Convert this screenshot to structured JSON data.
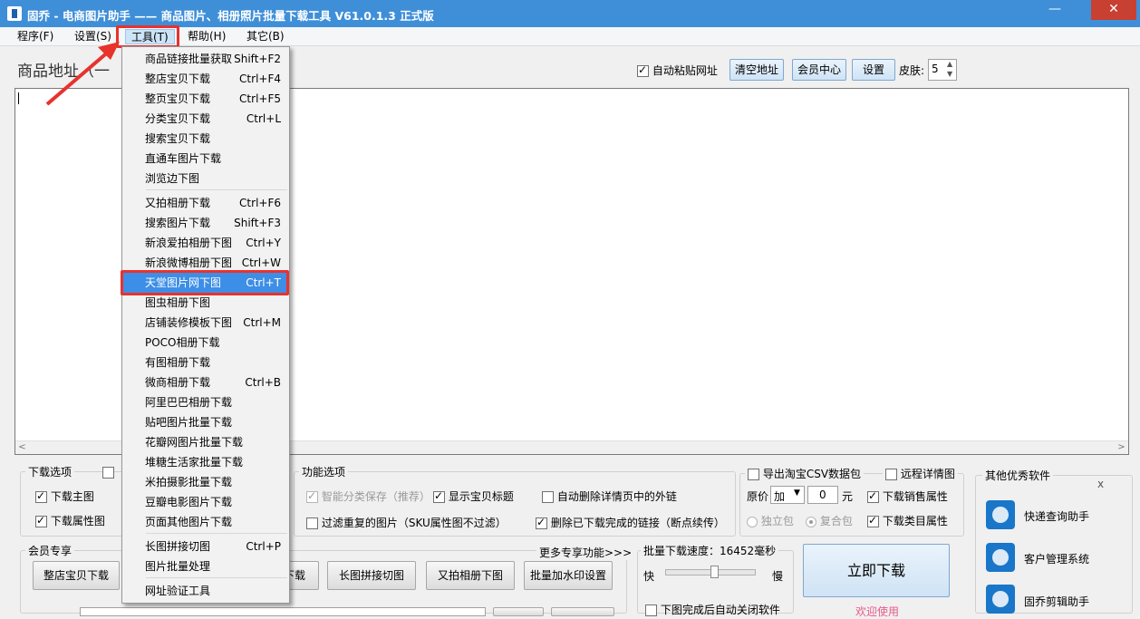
{
  "window": {
    "title": "固乔 - 电商图片助手 —— 商品图片、相册照片批量下载工具 V61.0.1.3 正式版",
    "minimize": "—",
    "close": "✕"
  },
  "menubar": [
    "程序(F)",
    "设置(S)",
    "工具(T)",
    "帮助(H)",
    "其它(B)"
  ],
  "main": {
    "url_label": "商品地址（一",
    "auto_paste": "自动粘贴网址",
    "clear_btn": "清空地址",
    "member_btn": "会员中心",
    "settings_btn": "设置",
    "skin_label": "皮肤:",
    "skin_value": "5"
  },
  "dropdown": [
    {
      "label": "商品链接批量获取",
      "shortcut": "Shift+F2"
    },
    {
      "label": "整店宝贝下载",
      "shortcut": "Ctrl+F4"
    },
    {
      "label": "整页宝贝下载",
      "shortcut": "Ctrl+F5"
    },
    {
      "label": "分类宝贝下载",
      "shortcut": "Ctrl+L"
    },
    {
      "label": "搜索宝贝下载",
      "shortcut": ""
    },
    {
      "label": "直通车图片下载",
      "shortcut": ""
    },
    {
      "label": "浏览边下图",
      "shortcut": ""
    },
    {
      "label": "又拍相册下载",
      "shortcut": "Ctrl+F6"
    },
    {
      "label": "搜索图片下载",
      "shortcut": "Shift+F3"
    },
    {
      "label": "新浪爱拍相册下图",
      "shortcut": "Ctrl+Y"
    },
    {
      "label": "新浪微博相册下图",
      "shortcut": "Ctrl+W"
    },
    {
      "label": "天堂图片网下图",
      "shortcut": "Ctrl+T"
    },
    {
      "label": "图虫相册下图",
      "shortcut": ""
    },
    {
      "label": "店铺装修模板下图",
      "shortcut": "Ctrl+M"
    },
    {
      "label": "POCO相册下载",
      "shortcut": ""
    },
    {
      "label": "有图相册下载",
      "shortcut": ""
    },
    {
      "label": "微商相册下载",
      "shortcut": "Ctrl+B"
    },
    {
      "label": "阿里巴巴相册下载",
      "shortcut": ""
    },
    {
      "label": "贴吧图片批量下载",
      "shortcut": ""
    },
    {
      "label": "花瓣网图片批量下载",
      "shortcut": ""
    },
    {
      "label": "堆糖生活家批量下载",
      "shortcut": ""
    },
    {
      "label": "米拍摄影批量下载",
      "shortcut": ""
    },
    {
      "label": "豆瓣电影图片下载",
      "shortcut": ""
    },
    {
      "label": "页面其他图片下载",
      "shortcut": ""
    },
    {
      "label": "长图拼接切图",
      "shortcut": "Ctrl+P"
    },
    {
      "label": "图片批量处理",
      "shortcut": ""
    },
    {
      "label": "网址验证工具",
      "shortcut": ""
    }
  ],
  "download_options": {
    "title": "下载选项",
    "main_img": "下载主图",
    "attr_img": "下载属性图"
  },
  "function_options": {
    "title": "功能选项",
    "smart_save": "智能分类保存（推荐）",
    "show_title": "显示宝贝标题",
    "auto_delete": "自动删除详情页中的外链",
    "filter_dup": "过滤重复的图片（SKU属性图不过滤）",
    "delete_done": "删除已下载完成的链接（断点续传）"
  },
  "csv": {
    "export": "导出淘宝CSV数据包",
    "remote": "远程详情图",
    "price_label": "原价",
    "op_value": "加",
    "price_value": "0",
    "unit": "元",
    "sales_attr": "下载销售属性",
    "single": "独立包",
    "composite": "复合包",
    "category_attr": "下载类目属性"
  },
  "member": {
    "title": "会员专享",
    "more": "更多专享功能>>>",
    "btn_shop": "整店宝贝下载",
    "btn_partial": "下载",
    "btn_long": "长图拼接切图",
    "btn_youpai": "又拍相册下图",
    "btn_watermark": "批量加水印设置"
  },
  "speed": {
    "label": "批量下载速度：16452毫秒",
    "fast": "快",
    "slow": "慢",
    "auto_close": "下图完成后自动关闭软件",
    "level": 0.55
  },
  "download_now": "立即下载",
  "welcome": "欢迎使用",
  "other_software": {
    "title": "其他优秀软件",
    "close": "x",
    "items": [
      "快递查询助手",
      "客户管理系统",
      "固乔剪辑助手"
    ],
    "icons": [
      "courier-icon",
      "customer-icon",
      "scissors-icon"
    ]
  },
  "colors": {
    "titlebar": "#3f8fd8",
    "highlight": "#3d8ee6",
    "annotation_red": "#e8322c"
  }
}
